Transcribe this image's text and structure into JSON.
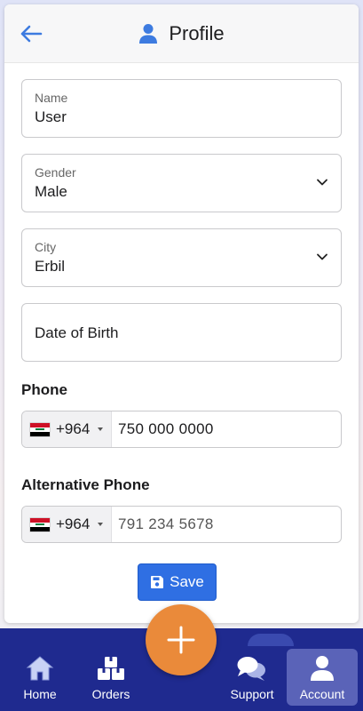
{
  "header": {
    "title": "Profile",
    "back_icon": "arrow-left-icon",
    "title_icon": "person-icon",
    "accent": "#3d7be0"
  },
  "form": {
    "name": {
      "label": "Name",
      "value": "User"
    },
    "gender": {
      "label": "Gender",
      "value": "Male"
    },
    "city": {
      "label": "City",
      "value": "Erbil"
    },
    "dob": {
      "placeholder": "Date of Birth"
    },
    "phone": {
      "label": "Phone",
      "country_code": "+964",
      "value": "750 000 0000"
    },
    "alt_phone": {
      "label": "Alternative Phone",
      "country_code": "+964",
      "placeholder": "791 234 5678"
    }
  },
  "save": {
    "label": "Save",
    "color": "#2f6fe3"
  },
  "nav": {
    "background": "#1f2a8f",
    "items": [
      {
        "label": "Home",
        "icon": "home-icon"
      },
      {
        "label": "Orders",
        "icon": "boxes-icon"
      },
      {
        "label": "Support",
        "icon": "chat-icon"
      },
      {
        "label": "Account",
        "icon": "user-icon",
        "active": true
      }
    ],
    "fab_icon": "plus-icon",
    "fab_color": "#ea8a3a"
  }
}
